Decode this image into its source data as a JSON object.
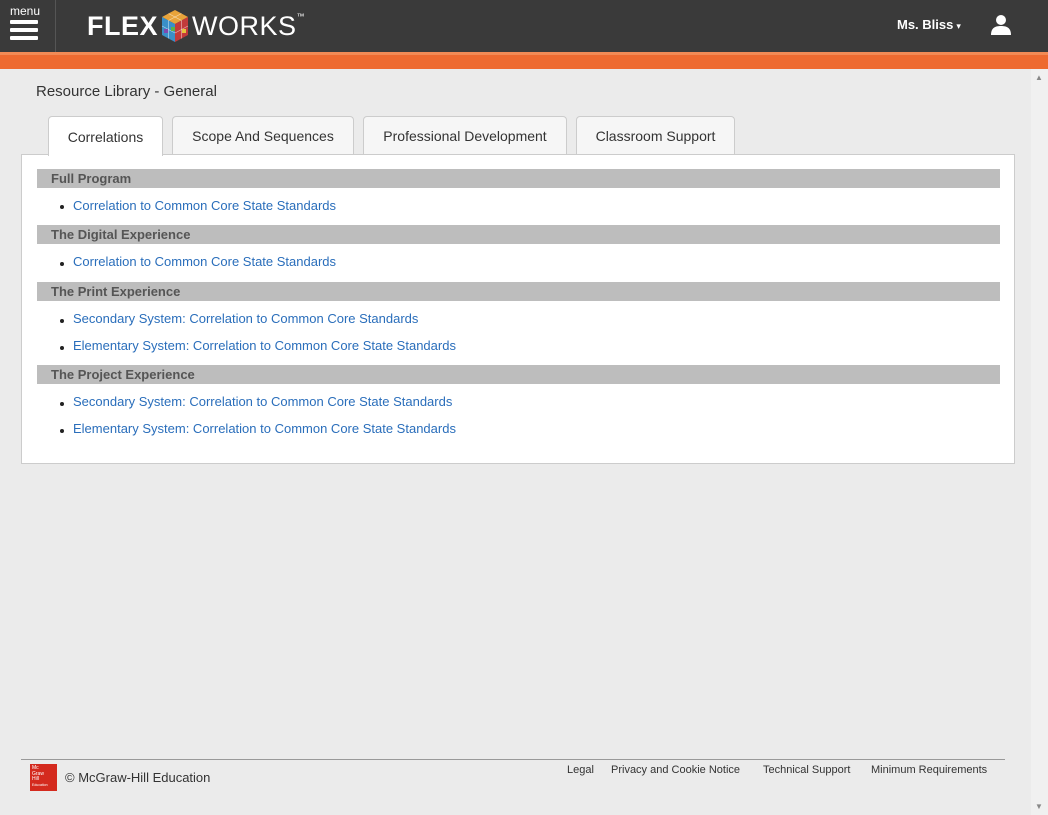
{
  "header": {
    "menu_label": "menu",
    "logo_flex": "FLEX",
    "logo_works": "WORKS",
    "logo_tm": "™",
    "user_name": "Ms. Bliss"
  },
  "page": {
    "title": "Resource Library - General"
  },
  "tabs": [
    {
      "label": "Correlations",
      "active": true
    },
    {
      "label": "Scope And Sequences",
      "active": false
    },
    {
      "label": "Professional Development",
      "active": false
    },
    {
      "label": "Classroom Support",
      "active": false
    }
  ],
  "sections": [
    {
      "heading": "Full Program",
      "links": [
        "Correlation to Common Core State Standards"
      ]
    },
    {
      "heading": "The Digital Experience",
      "links": [
        "Correlation to Common Core State Standards"
      ]
    },
    {
      "heading": "The Print Experience",
      "links": [
        "Secondary System: Correlation to Common Core Standards",
        "Elementary System: Correlation to Common Core State Standards"
      ]
    },
    {
      "heading": "The Project Experience",
      "links": [
        "Secondary System: Correlation to Common Core State Standards",
        "Elementary System: Correlation to Common Core State Standards"
      ]
    }
  ],
  "footer": {
    "copyright": "© McGraw-Hill Education",
    "logo_text": [
      "Mc",
      "Graw",
      "Hill",
      "Education"
    ],
    "links": [
      "Legal",
      "Privacy and Cookie Notice",
      "Technical Support",
      "Minimum Requirements"
    ]
  },
  "colors": {
    "topbar": "#3a3a3a",
    "accent": "#ee6a30",
    "link": "#2a6ebb",
    "section_head": "#bdbdbd"
  },
  "icons": [
    "menu-icon",
    "user-icon",
    "cube-logo-icon",
    "scroll-up-icon",
    "scroll-down-icon"
  ]
}
